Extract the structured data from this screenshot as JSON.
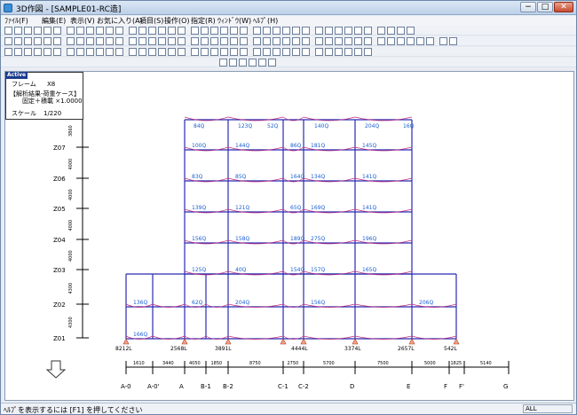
{
  "window": {
    "title": "3D作図 - [SAMPLE01-RC造]",
    "minimize": "−",
    "maximize": "□",
    "close": "✕"
  },
  "menu": [
    "ﾌｧｲﾙ(F)",
    "編集(E)",
    "表示(V)",
    "お気に入り(A)",
    "項目(S)",
    "操作(O)",
    "指定(R)",
    "ｳｨﾝﾄﾞｳ(W)",
    "ﾍﾙﾌﾟ(H)"
  ],
  "info": {
    "tag": "Active",
    "frame_label": "フレーム",
    "frame_value": "X8",
    "result_line1": "【解析結果-荷重ケース】",
    "result_line2": "固定＋積載 ×1.0000",
    "scale_label": "スケール",
    "scale_value": "1/220"
  },
  "levels": [
    {
      "name": "Z07",
      "height": "3860"
    },
    {
      "name": "Z06",
      "height": "4000"
    },
    {
      "name": "Z05",
      "height": "4000"
    },
    {
      "name": "Z04",
      "height": "4000"
    },
    {
      "name": "Z03",
      "height": "4000"
    },
    {
      "name": "Z02",
      "height": "4300"
    },
    {
      "name": "Z01",
      "height": "4300"
    }
  ],
  "grid_axes": [
    {
      "name": "A-0",
      "span": "1610"
    },
    {
      "name": "A-0'",
      "span": "3440"
    },
    {
      "name": "A",
      "span": "4050"
    },
    {
      "name": "B-1",
      "span": "1850"
    },
    {
      "name": "B-2",
      "span": "8750"
    },
    {
      "name": "C-1",
      "span": "2750"
    },
    {
      "name": "C-2",
      "span": "5700"
    },
    {
      "name": "D",
      "span": "7500"
    },
    {
      "name": "E",
      "span": "5000"
    },
    {
      "name": "F",
      "span": "1825"
    },
    {
      "name": "F'",
      "span": "5140"
    },
    {
      "name": "G",
      "span": ""
    }
  ],
  "reactions": [
    "8212L",
    "2568L",
    "3891L",
    "4444L",
    "3374L",
    "2657L",
    "542L"
  ],
  "beam_loads_top": [
    "84Q",
    "123Q",
    "52Q",
    "140Q",
    "204Q",
    "16Q"
  ],
  "beam_loads": [
    "100Q",
    "144Q",
    "86Q",
    "181Q",
    "145Q",
    "83Q",
    "85Q",
    "164Q",
    "134Q",
    "141Q",
    "139Q",
    "121Q",
    "65Q",
    "169Q",
    "141Q",
    "156Q",
    "158Q",
    "189Q",
    "275Q",
    "196Q",
    "125Q",
    "40Q",
    "154Q",
    "157Q",
    "165Q",
    "136Q",
    "62Q",
    "204Q",
    "156Q",
    "206Q",
    "166Q"
  ],
  "colors": {
    "member": "#2a2bb0",
    "label": "#1a5fd0",
    "moment": "#c23080"
  },
  "down_arrow_icon": "down-arrow-icon",
  "status": {
    "text": "ﾍﾙﾌﾟを表示するには [F1] を押してください",
    "mode": "ALL"
  }
}
